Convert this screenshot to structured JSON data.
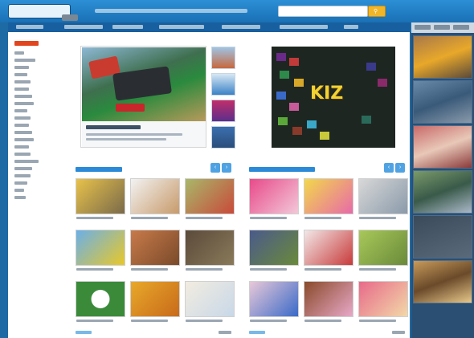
{
  "header": {
    "logo_text": "",
    "search_placeholder": "",
    "search_icon": "search-icon"
  },
  "nav": {
    "items": [
      "",
      "",
      "",
      "",
      "",
      "",
      ""
    ]
  },
  "categories": {
    "title": "",
    "items": [
      "",
      "",
      "",
      "",
      "",
      "",
      "",
      "",
      "",
      "",
      "",
      "",
      "",
      "",
      "",
      "",
      "",
      "",
      "",
      "",
      ""
    ]
  },
  "featured": {
    "title": "",
    "description": ""
  },
  "ad": {
    "logo": "KIZ"
  },
  "sections": [
    {
      "title": "",
      "prev_icon": "chevron-left-icon",
      "next_icon": "chevron-right-icon"
    },
    {
      "title": "",
      "prev_icon": "chevron-left-icon",
      "next_icon": "chevron-right-icon"
    }
  ],
  "colors": {
    "brand_blue": "#1d6aa5",
    "header_blue": "#2c8fd6",
    "accent_orange": "#f1b52a",
    "category_red": "#e2461f",
    "section_blue": "#2a8ad8"
  }
}
